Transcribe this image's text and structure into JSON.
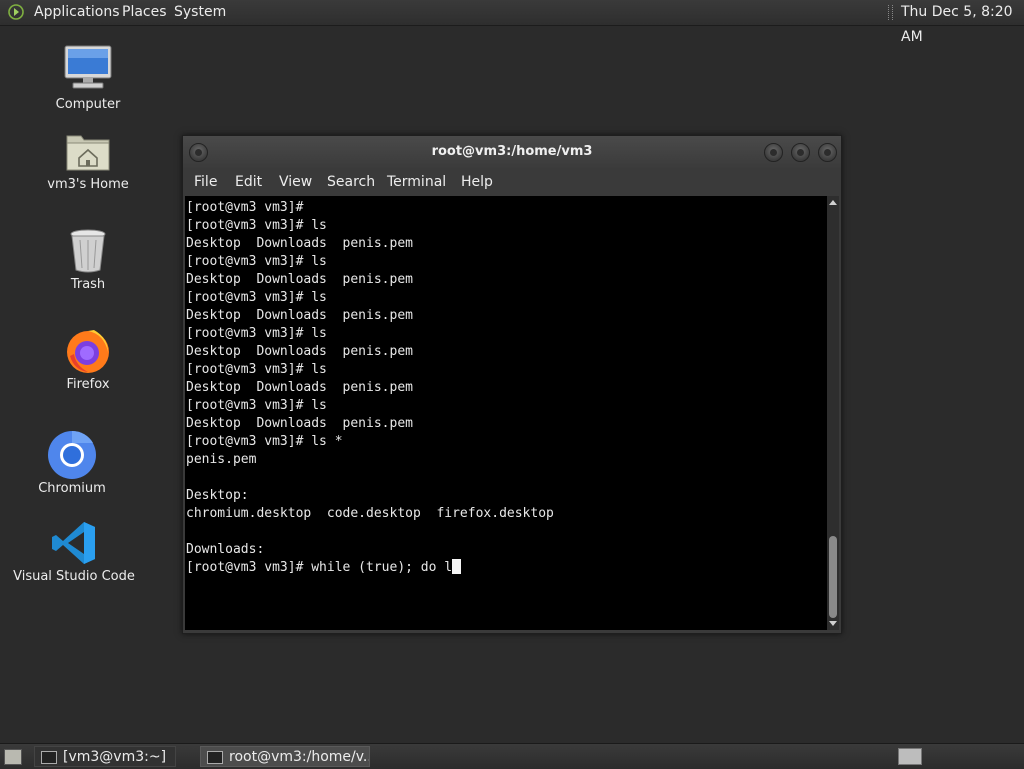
{
  "top_panel": {
    "applications": "Applications",
    "places": "Places",
    "system": "System",
    "clock": "Thu Dec  5,  8:20 AM"
  },
  "desktop_icons": [
    {
      "label": "Computer",
      "icon": "computer-icon"
    },
    {
      "label": "vm3's Home",
      "icon": "home-folder-icon"
    },
    {
      "label": "Trash",
      "icon": "trash-icon"
    },
    {
      "label": "Firefox",
      "icon": "firefox-icon"
    },
    {
      "label": "Chromium",
      "icon": "chromium-icon"
    },
    {
      "label": "Visual Studio Code",
      "icon": "vscode-icon"
    }
  ],
  "terminal": {
    "title": "root@vm3:/home/vm3",
    "menu": [
      "File",
      "Edit",
      "View",
      "Search",
      "Terminal",
      "Help"
    ],
    "lines": [
      "[root@vm3 vm3]#",
      "[root@vm3 vm3]# ls",
      "Desktop  Downloads  penis.pem",
      "[root@vm3 vm3]# ls",
      "Desktop  Downloads  penis.pem",
      "[root@vm3 vm3]# ls",
      "Desktop  Downloads  penis.pem",
      "[root@vm3 vm3]# ls",
      "Desktop  Downloads  penis.pem",
      "[root@vm3 vm3]# ls",
      "Desktop  Downloads  penis.pem",
      "[root@vm3 vm3]# ls",
      "Desktop  Downloads  penis.pem",
      "[root@vm3 vm3]# ls *",
      "penis.pem",
      "",
      "Desktop:",
      "chromium.desktop  code.desktop  firefox.desktop",
      "",
      "Downloads:"
    ],
    "input_line": "[root@vm3 vm3]# while (true); do l"
  },
  "taskbar": {
    "items": [
      "[vm3@vm3:~]",
      "root@vm3:/home/v..."
    ]
  },
  "colors": {
    "desktop_bg": "#2b2b2b",
    "terminal_bg": "#000000",
    "terminal_fg": "#e8e8e8"
  }
}
